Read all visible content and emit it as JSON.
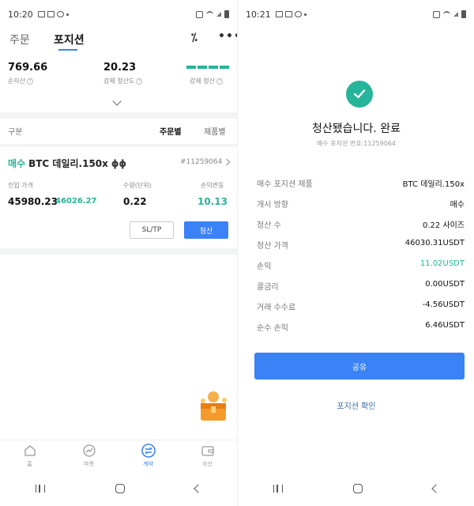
{
  "left": {
    "status_time": "10:20",
    "tabs": {
      "order": "주문",
      "position": "포지션"
    },
    "summary": {
      "net_asset_value": "769.66",
      "net_asset_label": "순자산",
      "margin_ratio_value": "20.23",
      "margin_ratio_label": "강제 청산도",
      "liquidation_label": "강제 청산"
    },
    "filter": {
      "label": "구분",
      "by_order": "주문별",
      "by_product": "제품별"
    },
    "position": {
      "side": "매수",
      "product": "BTC 데일리.150x",
      "id": "#11259064",
      "entry_label": "진입 가격",
      "qty_label": "수량(단위)",
      "pnl_label": "손익변동",
      "entry_price": "45980.23",
      "mark_price": "46026.27",
      "qty": "0.22",
      "pnl": "10.13",
      "sltp_label": "SL/TP",
      "close_label": "청산"
    },
    "bottom_nav": [
      {
        "label": "홈",
        "icon": "home-icon"
      },
      {
        "label": "마켓",
        "icon": "market-icon"
      },
      {
        "label": "계약",
        "icon": "contract-icon"
      },
      {
        "label": "자산",
        "icon": "wallet-icon"
      }
    ]
  },
  "right": {
    "status_time": "10:21",
    "title": "청산됐습니다. 완료",
    "subtitle": "매수 포지션 번호:11259064",
    "details": [
      {
        "label": "매수 포지션 제품",
        "value": "BTC 데일리.150x"
      },
      {
        "label": "개시 방향",
        "value": "매수"
      },
      {
        "label": "청산 수",
        "value": "0.22 사이즈"
      },
      {
        "label": "청산 가격",
        "value": "46030.31USDT"
      },
      {
        "label": "손익",
        "value": "11.02USDT"
      },
      {
        "label": "콜금리",
        "value": "0.00USDT"
      },
      {
        "label": "거래 수수료",
        "value": "-4.56USDT"
      },
      {
        "label": "순수 손익",
        "value": "6.46USDT"
      }
    ],
    "share_label": "공유",
    "confirm_label": "포지션 확인"
  },
  "colors": {
    "accent": "#3b82f6",
    "positive": "#26b49a"
  }
}
